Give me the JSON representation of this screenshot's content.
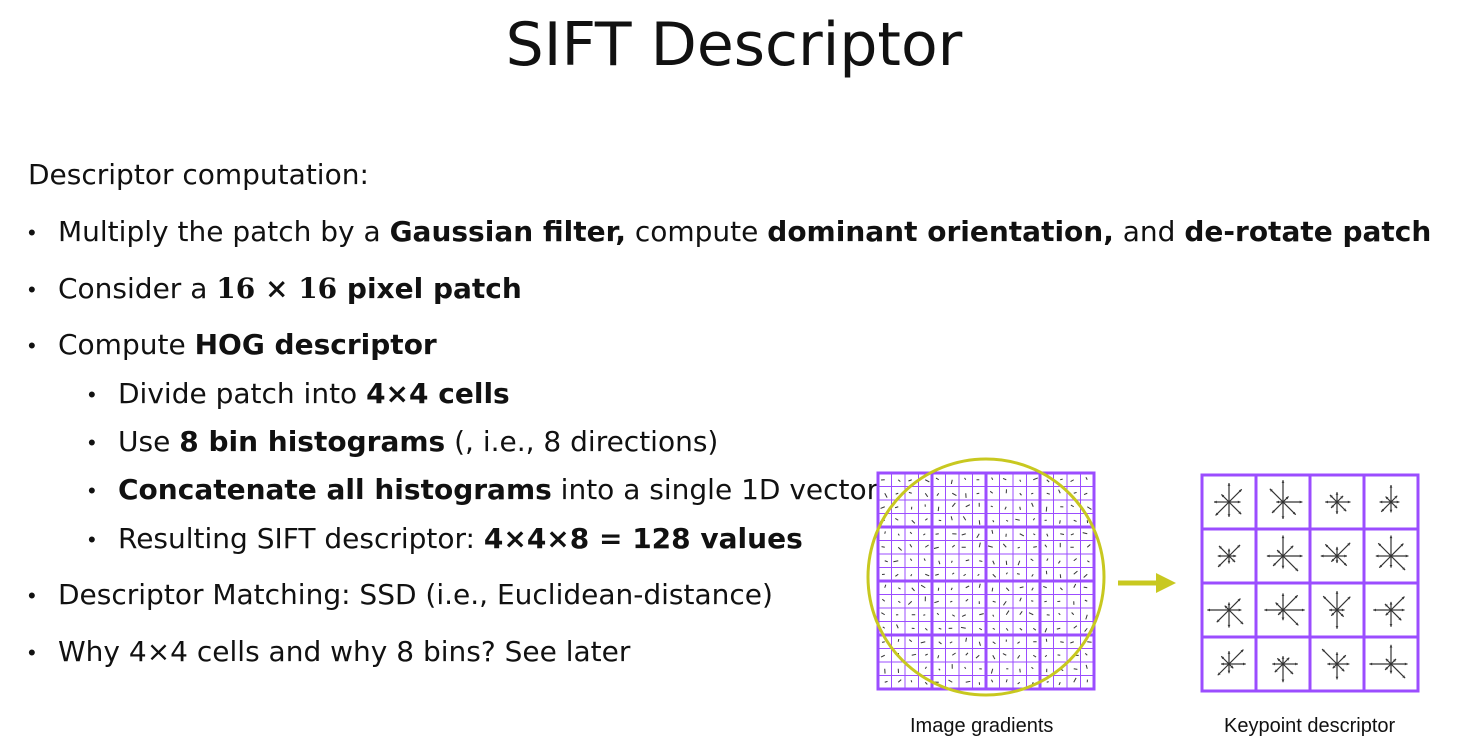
{
  "title": "SIFT Descriptor",
  "intro": "Descriptor computation:",
  "bullets": {
    "b1": {
      "t1": "Multiply the patch by a ",
      "b1": "Gaussian filter,",
      "t2": " compute ",
      "b2": "dominant orientation,",
      "t3": " and ",
      "b3": "de-rotate patch"
    },
    "b2": {
      "t1": "Consider a ",
      "math": "16 × 16",
      "b1": " pixel patch"
    },
    "b3": {
      "t1": "Compute ",
      "b1": "HOG descriptor"
    },
    "sub1": {
      "t1": "Divide patch into ",
      "b1": "4×4 cells"
    },
    "sub2": {
      "t1": "Use ",
      "b1": "8 bin histograms",
      "t2": " (, i.e., 8 directions)"
    },
    "sub3": {
      "b1": "Concatenate all histograms",
      "t1": " into a single 1D vector"
    },
    "sub4": {
      "t1": "Resulting SIFT descriptor: ",
      "b1": "4×4×8 = 128 values"
    },
    "b4": {
      "t1": "Descriptor Matching: SSD (i.e., Euclidean-distance)"
    },
    "b5": {
      "t1": "Why 4×4 cells and why 8 bins? See later"
    }
  },
  "figure": {
    "left_caption": "Image gradients",
    "right_caption": "Keypoint descriptor",
    "colors": {
      "grid": "#9b4dff",
      "circle": "#c8c820",
      "arrow": "#c8c820",
      "stroke": "#333333"
    }
  }
}
